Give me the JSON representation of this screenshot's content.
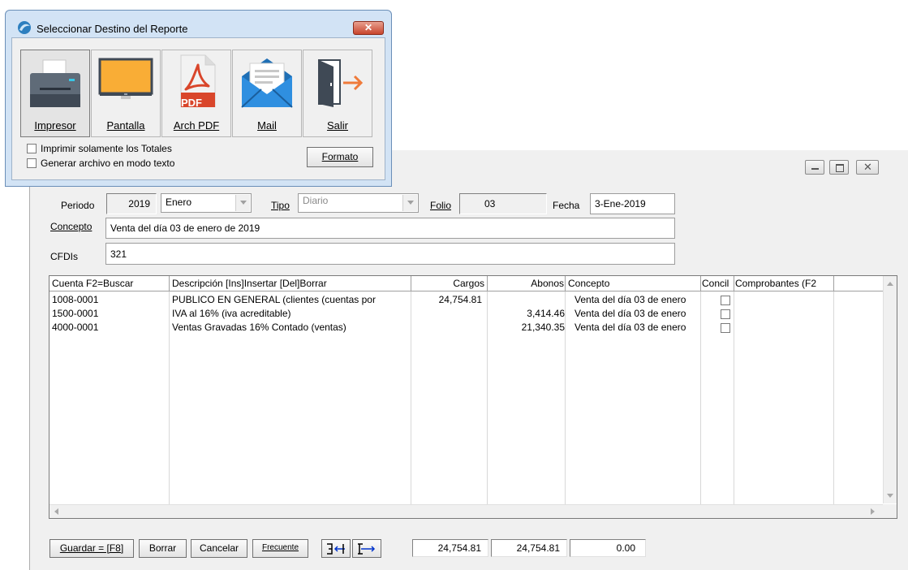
{
  "dialog": {
    "title": "Seleccionar Destino del Reporte",
    "buttons": [
      {
        "label": "Impresor",
        "icon": "printer-icon"
      },
      {
        "label": "Pantalla",
        "icon": "monitor-icon"
      },
      {
        "label": "Arch PDF",
        "icon": "pdf-icon",
        "badge": "PDF"
      },
      {
        "label": "Mail",
        "icon": "mail-icon"
      },
      {
        "label": "Salir",
        "icon": "exit-door-icon"
      }
    ],
    "checks": {
      "totales": "Imprimir solamente los Totales",
      "texto": "Generar archivo en modo texto"
    },
    "formato_label": "Formato"
  },
  "form": {
    "periodo_label": "Periodo",
    "periodo_year": "2019",
    "periodo_month": "Enero",
    "tipo_label": "Tipo",
    "tipo_value": "Diario",
    "folio_label": "Folio",
    "folio_value": "03",
    "fecha_label": "Fecha",
    "fecha_value": "3-Ene-2019",
    "concepto_label": "Concepto",
    "concepto_value": "Venta del día 03 de enero de 2019",
    "cfdis_label": "CFDIs",
    "cfdis_value": "321"
  },
  "grid": {
    "columns": [
      "Cuenta F2=Buscar",
      "Descripción  [Ins]Insertar  [Del]Borrar",
      "Cargos",
      "Abonos",
      "Concepto",
      "Concil",
      "Comprobantes (F2"
    ],
    "rows": [
      {
        "cuenta": "1008-0001",
        "descripcion": "PUBLICO EN GENERAL (clientes (cuentas por",
        "cargos": "24,754.81",
        "abonos": "",
        "concepto": "Venta del día 03 de enero"
      },
      {
        "cuenta": "1500-0001",
        "descripcion": "IVA al 16% (iva acreditable)",
        "cargos": "",
        "abonos": "3,414.46",
        "concepto": "Venta del día 03 de enero"
      },
      {
        "cuenta": "4000-0001",
        "descripcion": "Ventas Gravadas 16% Contado (ventas)",
        "cargos": "",
        "abonos": "21,340.35",
        "concepto": "Venta del día 03 de enero"
      }
    ]
  },
  "footer": {
    "guardar": "Guardar = [F8]",
    "borrar": "Borrar",
    "cancelar": "Cancelar",
    "frecuente": "Frecuente",
    "total_cargos": "24,754.81",
    "total_abonos": "24,754.81",
    "diferencia": "0.00"
  }
}
